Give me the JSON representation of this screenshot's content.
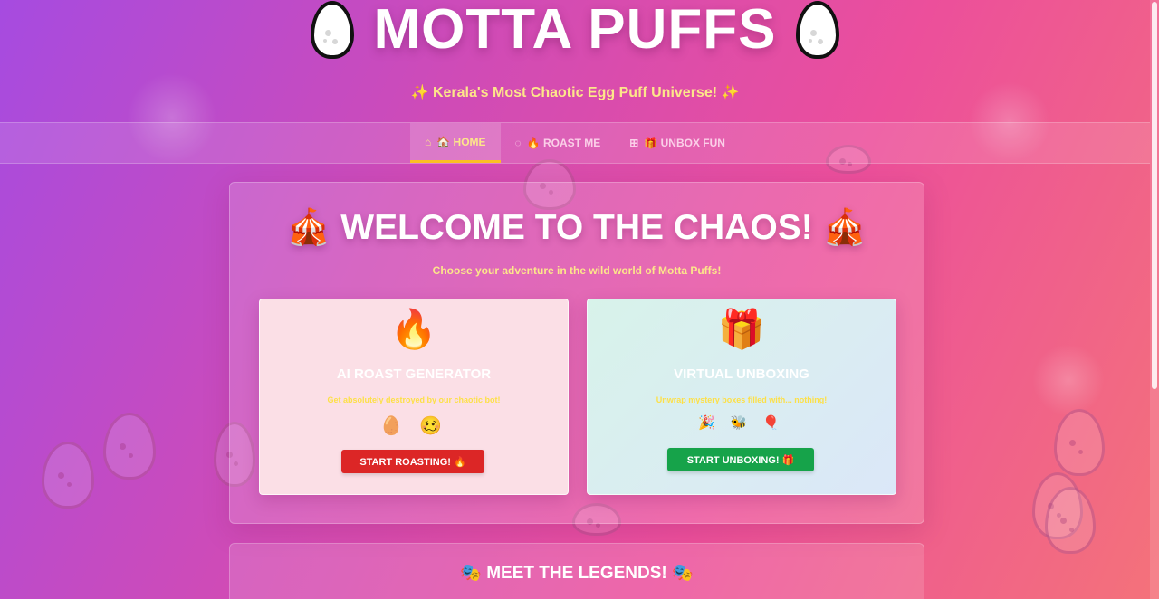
{
  "header": {
    "title": "MOTTA PUFFS",
    "tagline": "✨ Kerala's Most Chaotic Egg Puff Universe! ✨",
    "logo_icon": "egg-icon"
  },
  "nav": {
    "items": [
      {
        "icon": "⌂",
        "label": "🏠 HOME",
        "active": true
      },
      {
        "icon": "◌",
        "label": "🔥 ROAST ME",
        "active": false
      },
      {
        "icon": "⊞",
        "label": "🎁 UNBOX FUN",
        "active": false
      }
    ]
  },
  "welcome": {
    "title": "🎪 WELCOME TO THE CHAOS! 🎪",
    "subtitle": "Choose your adventure in the wild world of Motta Puffs!"
  },
  "cards": {
    "roast": {
      "emoji": "🔥",
      "title": "AI ROAST GENERATOR",
      "description": "Get absolutely destroyed by our chaotic bot!",
      "icons": "🥚 🥴",
      "button": "START ROASTING! 🔥"
    },
    "unbox": {
      "emoji": "🎁",
      "title": "VIRTUAL UNBOXING",
      "description": "Unwrap mystery boxes filled with... nothing!",
      "icons": "🎉 🐝 🎈",
      "button": "START UNBOXING! 🎁"
    }
  },
  "legends": {
    "title": "🎭 MEET THE LEGENDS! 🎭"
  },
  "colors": {
    "accent_yellow": "#fde68a",
    "roast_button": "#dc2626",
    "unbox_button": "#16a34a"
  }
}
